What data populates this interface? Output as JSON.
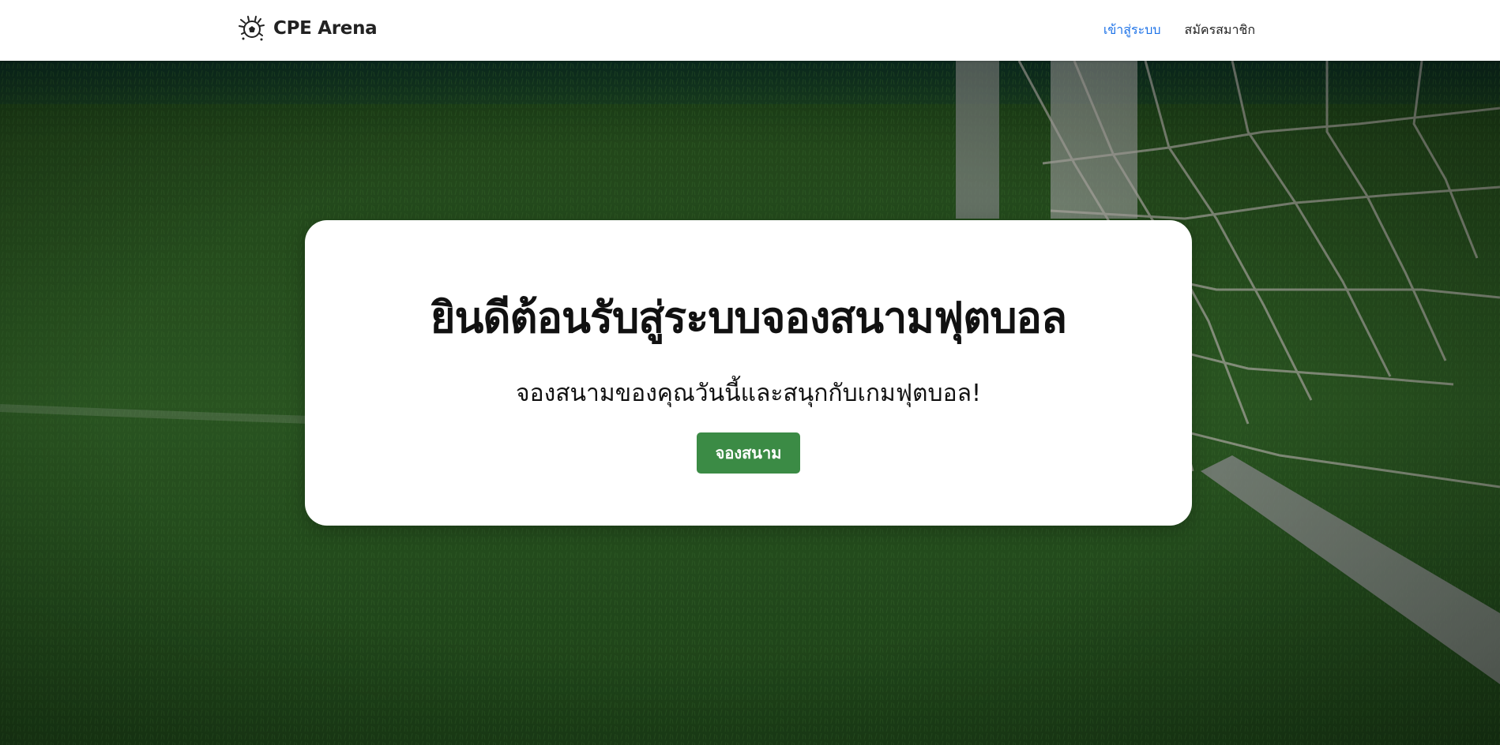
{
  "navbar": {
    "brand_name": "CPE Arena",
    "brand_icon": "soccer-ball-icon",
    "links": {
      "login": "เข้าสู่ระบบ",
      "register": "สมัครสมาชิก"
    }
  },
  "hero": {
    "title": "ยินดีต้อนรับสู่ระบบจองสนามฟุตบอล",
    "subtitle": "จองสนามของคุณวันนี้และสนุกกับเกมฟุตบอล!",
    "cta_label": "จองสนาม"
  },
  "colors": {
    "accent_link": "#1e73e8",
    "cta_button": "#3b8b45",
    "nav_text": "#222222"
  }
}
